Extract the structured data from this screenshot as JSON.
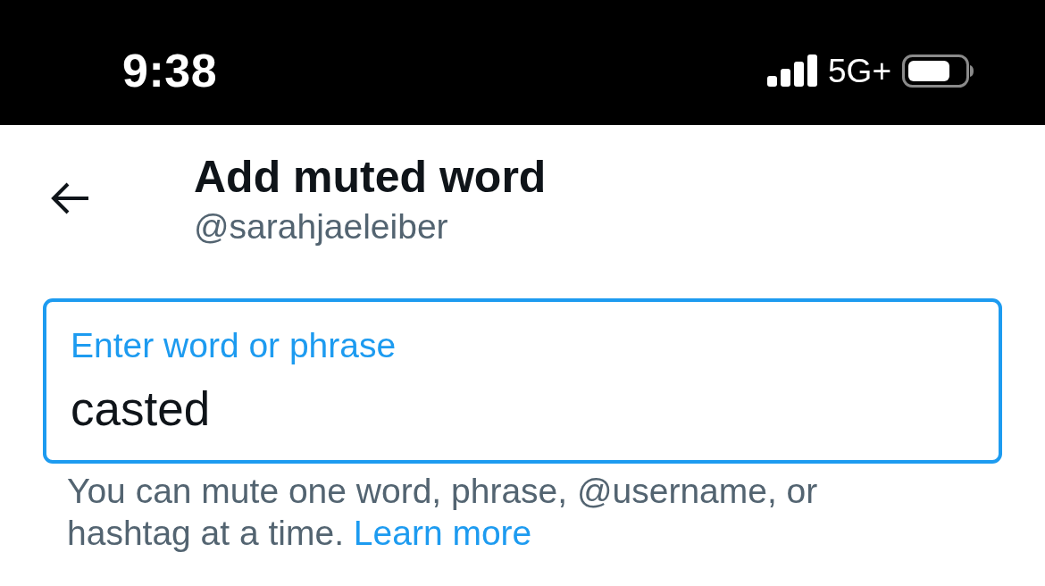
{
  "status_bar": {
    "time": "9:38",
    "network": "5G+"
  },
  "header": {
    "title": "Add muted word",
    "username": "@sarahjaeleiber"
  },
  "field": {
    "label": "Enter word or phrase",
    "value": "casted",
    "focused": true
  },
  "help": {
    "text": "You can mute one word, phrase, @username, or hashtag at a time.",
    "link": "Learn more"
  }
}
